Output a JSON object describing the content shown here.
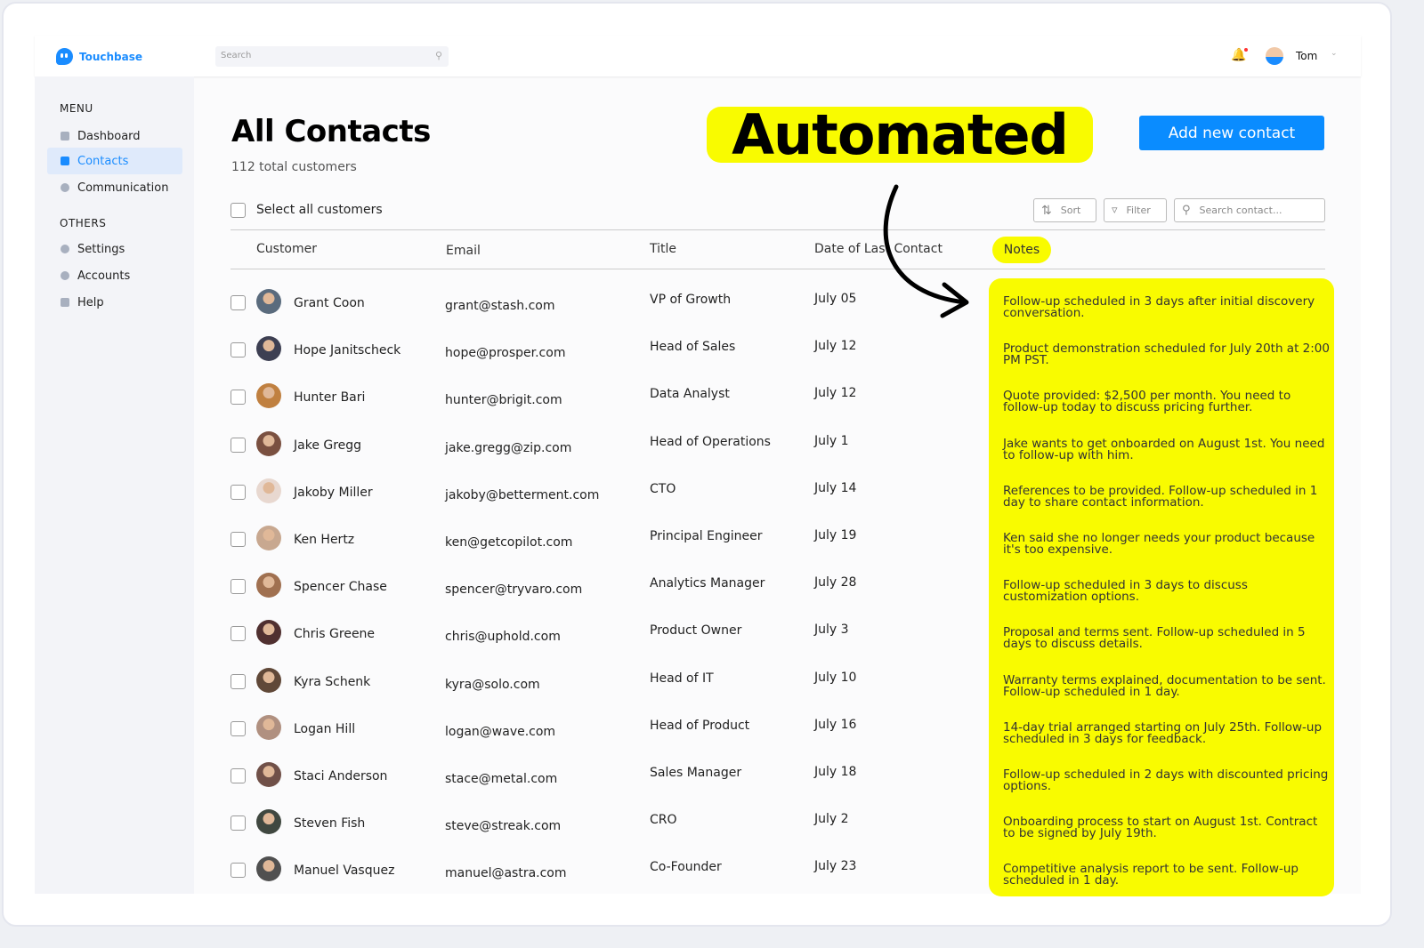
{
  "app": {
    "name": "Touchbase"
  },
  "topbar": {
    "search_placeholder": "Search",
    "user_name": "Tom"
  },
  "sidebar": {
    "menu_label": "MENU",
    "menu": [
      {
        "label": "Dashboard",
        "icon": "chart-icon"
      },
      {
        "label": "Contacts",
        "icon": "document-icon",
        "active": true
      },
      {
        "label": "Communication",
        "icon": "chat-icon"
      }
    ],
    "others_label": "OTHERS",
    "others": [
      {
        "label": "Settings",
        "icon": "gear-icon"
      },
      {
        "label": "Accounts",
        "icon": "user-icon"
      },
      {
        "label": "Help",
        "icon": "info-icon"
      }
    ]
  },
  "page": {
    "title": "All Contacts",
    "subtitle": "112 total customers",
    "annotation": "Automated",
    "add_button": "Add new contact",
    "select_all": "Select all customers",
    "sort": "Sort",
    "filter": "Filter",
    "search_placeholder": "Search contact..."
  },
  "columns": [
    "Customer",
    "Email",
    "Title",
    "Date of Last Contact",
    "Notes"
  ],
  "colors": {
    "accent": "#0a8cff",
    "highlight": "#f9fb00"
  },
  "contacts": [
    {
      "name": "Grant Coon",
      "email": "grant@stash.com",
      "title": "VP of Growth",
      "date": "July 05",
      "note": "Follow-up scheduled in 3 days after initial discovery conversation."
    },
    {
      "name": "Hope Janitscheck",
      "email": "hope@prosper.com",
      "title": "Head of Sales",
      "date": "July 12",
      "note": "Product demonstration scheduled for July 20th at 2:00 PM PST."
    },
    {
      "name": "Hunter Bari",
      "email": "hunter@brigit.com",
      "title": "Data Analyst",
      "date": "July 12",
      "note": "Quote provided: $2,500 per month. You need to follow-up today to discuss pricing further."
    },
    {
      "name": "Jake Gregg",
      "email": "jake.gregg@zip.com",
      "title": "Head of Operations",
      "date": "July 1",
      "note": "Jake wants to get onboarded on August 1st. You need to follow-up with him."
    },
    {
      "name": "Jakoby Miller",
      "email": "jakoby@betterment.com",
      "title": "CTO",
      "date": "July 14",
      "note": "References to be provided. Follow-up scheduled in 1 day to share contact information."
    },
    {
      "name": "Ken Hertz",
      "email": "ken@getcopilot.com",
      "title": "Principal Engineer",
      "date": "July 19",
      "note": "Ken said she no longer needs your product because it's too expensive."
    },
    {
      "name": "Spencer Chase",
      "email": "spencer@tryvaro.com",
      "title": "Analytics Manager",
      "date": "July 28",
      "note": "Follow-up scheduled in 3 days to discuss customization options."
    },
    {
      "name": "Chris Greene",
      "email": "chris@uphold.com",
      "title": "Product Owner",
      "date": "July 3",
      "note": "Proposal and terms sent. Follow-up scheduled in 5 days to discuss details."
    },
    {
      "name": "Kyra Schenk",
      "email": "kyra@solo.com",
      "title": "Head of IT",
      "date": "July 10",
      "note": "Warranty terms explained, documentation to be sent. Follow-up scheduled in 1 day."
    },
    {
      "name": "Logan Hill",
      "email": "logan@wave.com",
      "title": "Head of Product",
      "date": "July 16",
      "note": "14-day trial arranged starting on July 25th. Follow-up scheduled in 3 days for feedback."
    },
    {
      "name": "Staci Anderson",
      "email": "stace@metal.com",
      "title": "Sales Manager",
      "date": "July 18",
      "note": "Follow-up scheduled in 2 days with discounted pricing options."
    },
    {
      "name": "Steven Fish",
      "email": "steve@streak.com",
      "title": "CRO",
      "date": "July 2",
      "note": "Onboarding process to start on August 1st. Contract to be signed by July 19th."
    },
    {
      "name": "Manuel Vasquez",
      "email": "manuel@astra.com",
      "title": "Co-Founder",
      "date": "July 23",
      "note": "Competitive analysis report to be sent. Follow-up scheduled in 1 day."
    }
  ]
}
